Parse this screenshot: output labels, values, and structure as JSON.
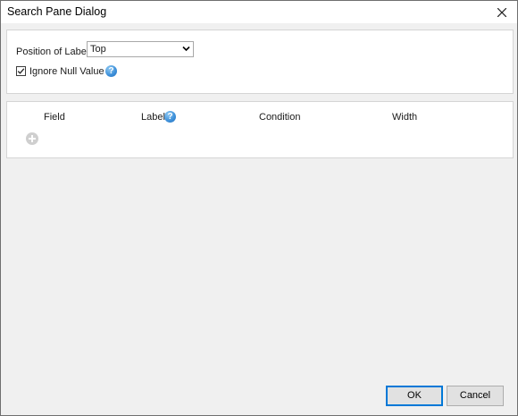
{
  "window": {
    "title": "Search Pane Dialog"
  },
  "settings": {
    "position_label": "Position of Label",
    "position_value": "Top",
    "ignore_null_label": "Ignore Null Value",
    "ignore_null_checked": true
  },
  "grid": {
    "columns": [
      "Field",
      "Label",
      "Condition",
      "Width"
    ]
  },
  "footer": {
    "ok_label": "OK",
    "cancel_label": "Cancel"
  },
  "icons": {
    "help": "help-icon",
    "add": "add-icon",
    "close": "close-icon",
    "dropdown": "chevron-down-icon"
  },
  "colors": {
    "help_blue": "#3b8ed8",
    "ok_border": "#0078d7"
  }
}
